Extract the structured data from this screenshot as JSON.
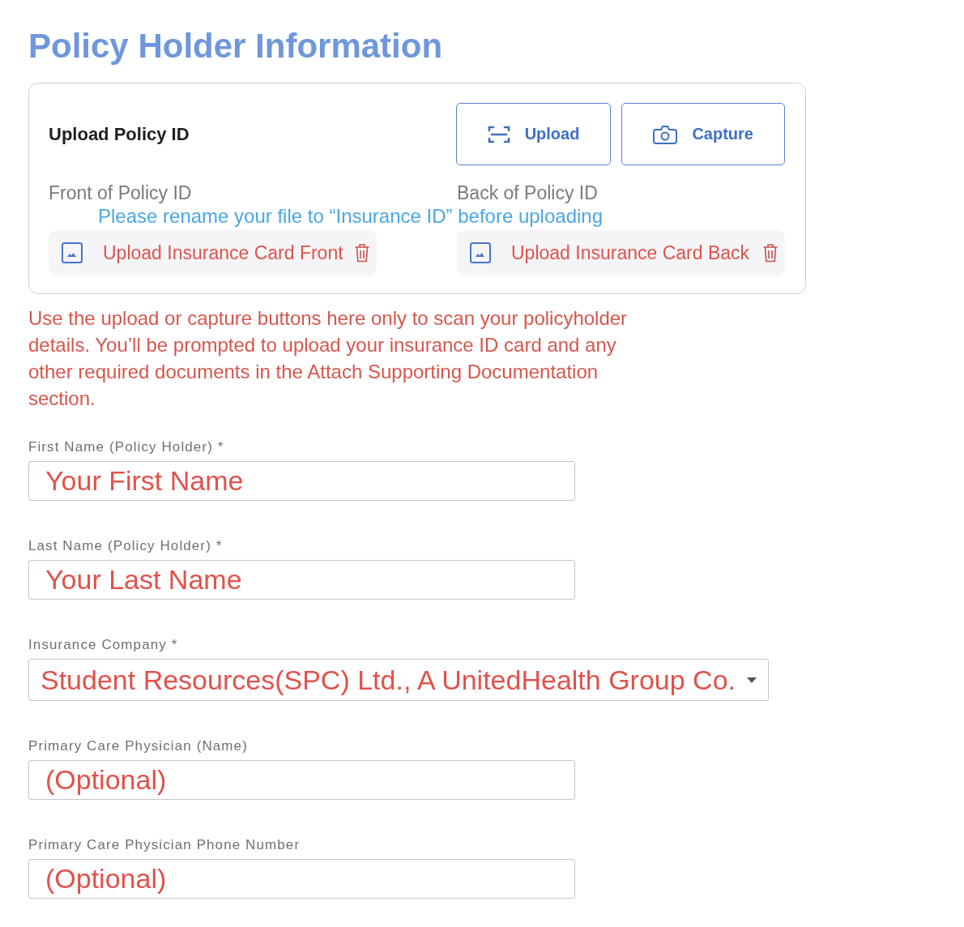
{
  "page": {
    "title": "Policy Holder Information"
  },
  "upload_card": {
    "title": "Upload Policy ID",
    "buttons": [
      {
        "label": "Upload",
        "kind": "scan"
      },
      {
        "label": "Capture",
        "kind": "camera"
      }
    ],
    "note": "Please rename your file to “Insurance ID” before uploading",
    "slots": [
      {
        "label": "Front of Policy ID",
        "file_prompt": "Upload Insurance Card Front"
      },
      {
        "label": "Back of Policy ID",
        "file_prompt": "Upload Insurance Card Back"
      }
    ]
  },
  "instructions": "Use the upload or capture buttons here only to scan your policyholder details. You’ll be prompted to upload your insurance ID card and any other required documents in the Attach Supporting Documentation section.",
  "fields": [
    {
      "label": "First Name (Policy Holder) *",
      "kind": "text",
      "value": "Your First Name"
    },
    {
      "label": "Last Name (Policy Holder) *",
      "kind": "text",
      "value": "Your Last Name"
    },
    {
      "label": "Insurance Company *",
      "kind": "select",
      "value": "Student Resources(SPC) Ltd., A UnitedHealth Group Co."
    },
    {
      "label": "Primary Care Physician (Name)",
      "kind": "text",
      "value": "(Optional)"
    },
    {
      "label": "Primary Care Physician Phone Number",
      "kind": "text",
      "value": "(Optional)"
    }
  ]
}
